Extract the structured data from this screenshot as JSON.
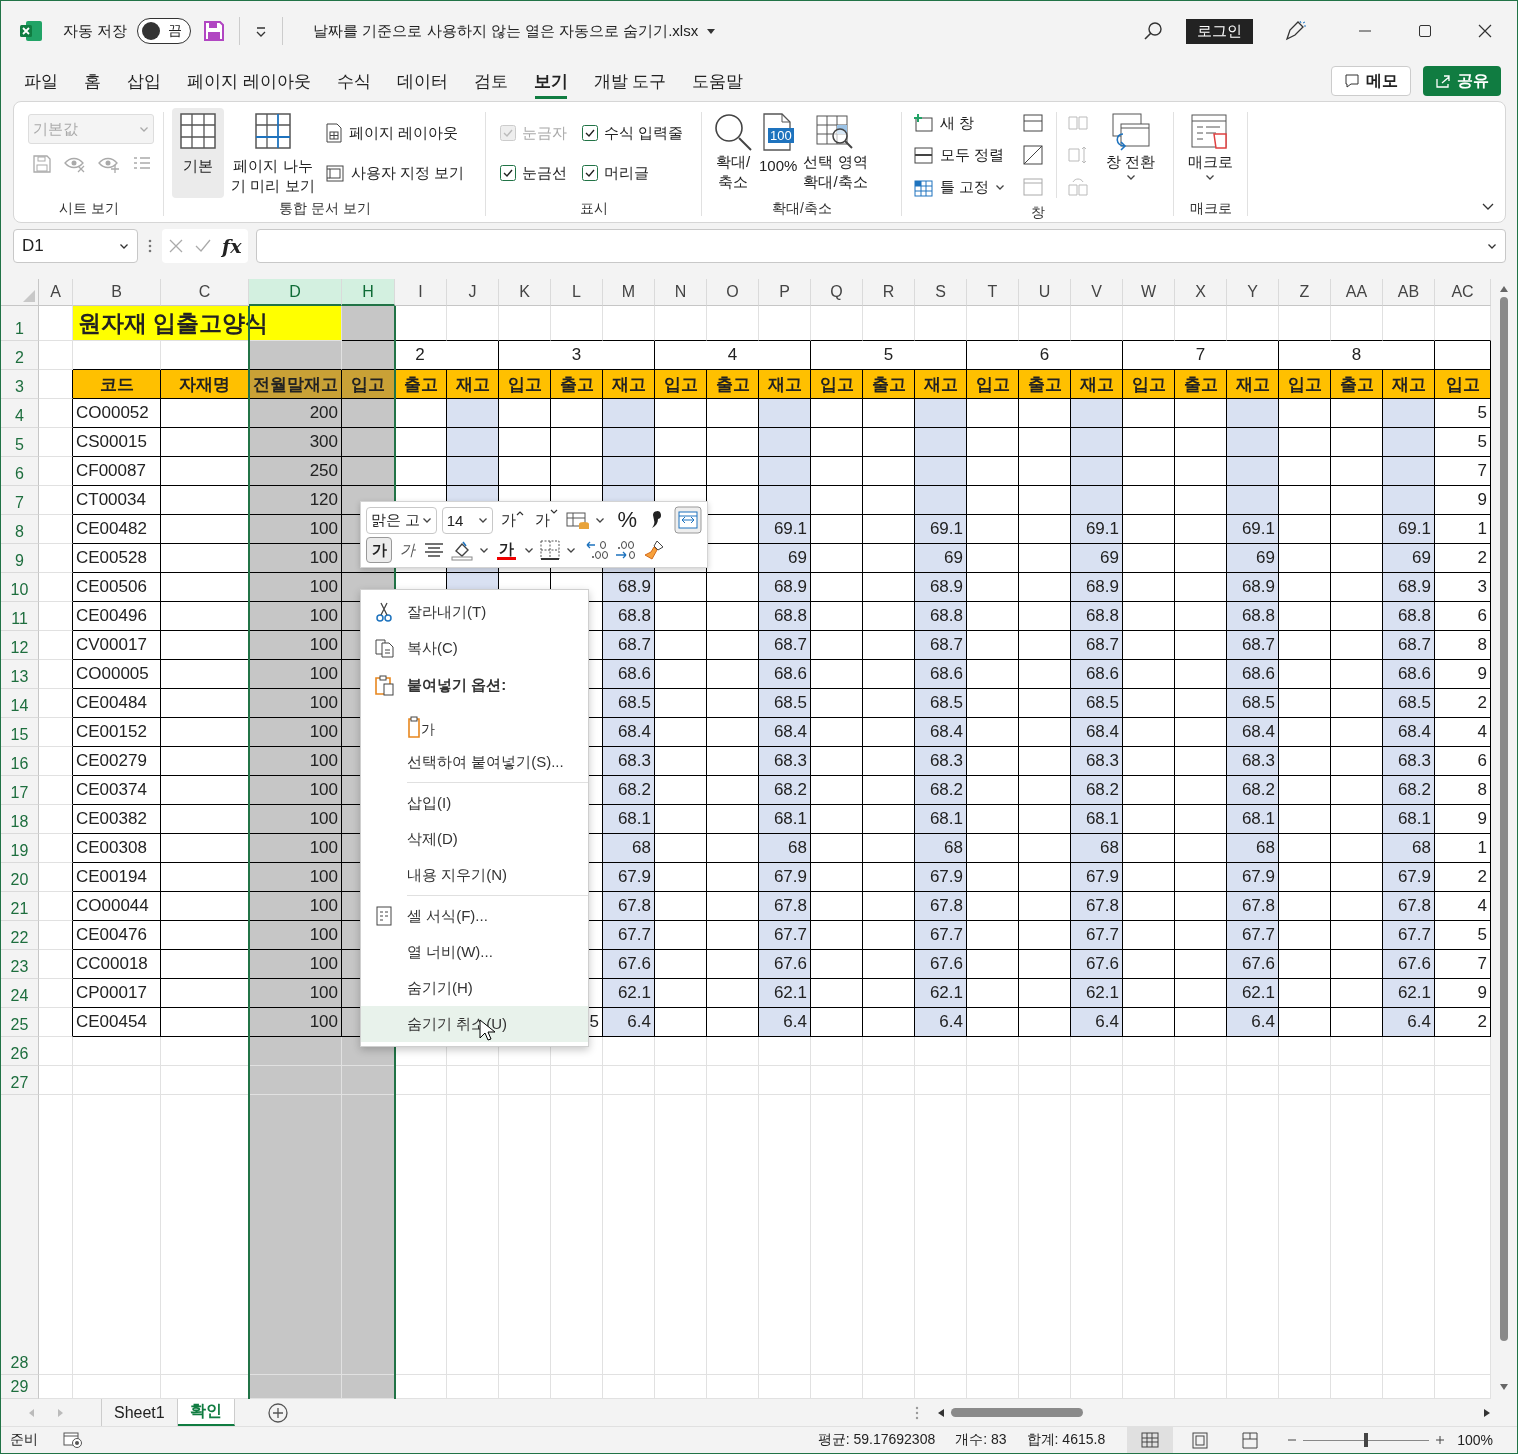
{
  "title_bar": {
    "autosave_label": "자동 저장",
    "autosave_toggle": {
      "label": "끔",
      "on": false
    },
    "file_name": "날짜를 기준으로 사용하지 않는 열은 자동으로 숨기기.xlsx",
    "login": "로그인"
  },
  "ribbon_tabs": [
    {
      "label": "파일",
      "selected": false
    },
    {
      "label": "홈",
      "selected": false
    },
    {
      "label": "삽입",
      "selected": false
    },
    {
      "label": "페이지 레이아웃",
      "selected": false
    },
    {
      "label": "수식",
      "selected": false
    },
    {
      "label": "데이터",
      "selected": false
    },
    {
      "label": "검토",
      "selected": false
    },
    {
      "label": "보기",
      "selected": true
    },
    {
      "label": "개발 도구",
      "selected": false
    },
    {
      "label": "도움말",
      "selected": false
    }
  ],
  "memo_button": "메모",
  "share_button": "공유",
  "ribbon": {
    "sheet_view": {
      "label": "시트 보기",
      "view_dropdown": {
        "value": "기본값",
        "disabled": true
      }
    },
    "workbook_views": {
      "label": "통합 문서 보기",
      "large_buttons": [
        {
          "label": "기본",
          "selected": true
        },
        {
          "label": "페이지 나누\n기 미리 보기",
          "selected": false
        }
      ],
      "small_buttons": [
        "페이지 레이아웃",
        "사용자 지정 보기"
      ]
    },
    "show": {
      "label": "표시",
      "checkboxes": [
        {
          "label": "눈금자",
          "checked": true,
          "disabled": true
        },
        {
          "label": "수식 입력줄",
          "checked": true,
          "disabled": false
        },
        {
          "label": "눈금선",
          "checked": true,
          "disabled": false
        },
        {
          "label": "머리글",
          "checked": true,
          "disabled": false
        }
      ]
    },
    "zoom": {
      "label": "확대/축소",
      "zoom_button": "확대/\n축소",
      "hundred_button": {
        "label": "100%",
        "badge": "100"
      },
      "selection_button": "선택 영역\n확대/축소"
    },
    "window": {
      "label": "창",
      "small_buttons": [
        "새 창",
        "모두 정렬",
        "틀 고정"
      ],
      "switch_button": "창 전환"
    },
    "macros": {
      "label": "매크로",
      "button": "매크로"
    }
  },
  "formula_bar": {
    "name_box": "D1",
    "function_label": "fx"
  },
  "sheet": {
    "columns": [
      {
        "label": "A",
        "selected": false,
        "shaded": false
      },
      {
        "label": "B",
        "selected": false,
        "shaded": false
      },
      {
        "label": "C",
        "selected": false,
        "shaded": false
      },
      {
        "label": "D",
        "selected": true,
        "shaded": false
      },
      {
        "label": "H",
        "selected": true,
        "shaded": false
      },
      {
        "label": "I",
        "selected": false,
        "shaded": false
      },
      {
        "label": "J",
        "selected": false,
        "shaded": true
      },
      {
        "label": "K",
        "selected": false,
        "shaded": false
      },
      {
        "label": "L",
        "selected": false,
        "shaded": false
      },
      {
        "label": "M",
        "selected": false,
        "shaded": true
      },
      {
        "label": "N",
        "selected": false,
        "shaded": false
      },
      {
        "label": "O",
        "selected": false,
        "shaded": false
      },
      {
        "label": "P",
        "selected": false,
        "shaded": true
      },
      {
        "label": "Q",
        "selected": false,
        "shaded": false
      },
      {
        "label": "R",
        "selected": false,
        "shaded": false
      },
      {
        "label": "S",
        "selected": false,
        "shaded": true
      },
      {
        "label": "T",
        "selected": false,
        "shaded": false
      },
      {
        "label": "U",
        "selected": false,
        "shaded": false
      },
      {
        "label": "V",
        "selected": false,
        "shaded": true
      },
      {
        "label": "W",
        "selected": false,
        "shaded": false
      },
      {
        "label": "X",
        "selected": false,
        "shaded": false
      },
      {
        "label": "Y",
        "selected": false,
        "shaded": true
      },
      {
        "label": "Z",
        "selected": false,
        "shaded": false
      },
      {
        "label": "AA",
        "selected": false,
        "shaded": false
      },
      {
        "label": "AB",
        "selected": false,
        "shaded": true
      },
      {
        "label": "AC",
        "selected": false,
        "shaded": false
      }
    ],
    "row_numbers": [
      "1",
      "2",
      "3",
      "4",
      "5",
      "6",
      "7",
      "8",
      "9",
      "10",
      "11",
      "12",
      "13",
      "14",
      "15",
      "16",
      "17",
      "18",
      "19",
      "20",
      "21",
      "22",
      "23",
      "24",
      "25",
      "26",
      "27",
      "28",
      "29"
    ],
    "title": "원자재 입출고양식",
    "months": [
      "2",
      "3",
      "4",
      "5",
      "6",
      "7",
      "8"
    ],
    "headers": [
      "코드",
      "자재명",
      "전월말재고",
      "입고",
      "출고",
      "재고",
      "입고",
      "출고",
      "재고",
      "입고",
      "출고",
      "재고",
      "입고",
      "출고",
      "재고",
      "입고",
      "출고",
      "재고",
      "입고",
      "출고",
      "재고",
      "입고",
      "출고",
      "재고",
      "입고"
    ],
    "rows": [
      {
        "code": "CO00052",
        "prev_stock": "200",
        "next_in": "5"
      },
      {
        "code": "CS00015",
        "prev_stock": "300",
        "next_in": "5"
      },
      {
        "code": "CF00087",
        "prev_stock": "250",
        "next_in": "7"
      },
      {
        "code": "CT00034",
        "prev_stock": "120",
        "next_in": "9"
      },
      {
        "code": "CE00482",
        "prev_stock": "100",
        "stock": [
          "69.1",
          "69.1",
          "69.1",
          "69.1",
          "69.1"
        ],
        "next_in": "1"
      },
      {
        "code": "CE00528",
        "prev_stock": "100",
        "stock": [
          "69",
          "69",
          "69",
          "69",
          "69"
        ],
        "next_in": "2"
      },
      {
        "code": "CE00506",
        "prev_stock": "100",
        "stock": [
          "68.9",
          "68.9",
          "68.9",
          "68.9",
          "68.9",
          "68.9"
        ],
        "next_in": "3"
      },
      {
        "code": "CE00496",
        "prev_stock": "100",
        "stock": [
          "68.8",
          "68.8",
          "68.8",
          "68.8",
          "68.8",
          "68.8"
        ],
        "next_in": "6"
      },
      {
        "code": "CV00017",
        "prev_stock": "100",
        "stock": [
          "68.7",
          "68.7",
          "68.7",
          "68.7",
          "68.7",
          "68.7"
        ],
        "next_in": "8"
      },
      {
        "code": "CO00005",
        "prev_stock": "100",
        "stock": [
          "68.6",
          "68.6",
          "68.6",
          "68.6",
          "68.6",
          "68.6"
        ],
        "next_in": "9"
      },
      {
        "code": "CE00484",
        "prev_stock": "100",
        "stock": [
          "68.5",
          "68.5",
          "68.5",
          "68.5",
          "68.5",
          "68.5"
        ],
        "next_in": "2"
      },
      {
        "code": "CE00152",
        "prev_stock": "100",
        "stock": [
          "68.4",
          "68.4",
          "68.4",
          "68.4",
          "68.4",
          "68.4"
        ],
        "next_in": "4"
      },
      {
        "code": "CE00279",
        "prev_stock": "100",
        "stock": [
          "68.3",
          "68.3",
          "68.3",
          "68.3",
          "68.3",
          "68.3"
        ],
        "next_in": "6"
      },
      {
        "code": "CE00374",
        "prev_stock": "100",
        "stock": [
          "68.2",
          "68.2",
          "68.2",
          "68.2",
          "68.2",
          "68.2"
        ],
        "next_in": "8"
      },
      {
        "code": "CE00382",
        "prev_stock": "100",
        "stock": [
          "68.1",
          "68.1",
          "68.1",
          "68.1",
          "68.1",
          "68.1"
        ],
        "next_in": "9"
      },
      {
        "code": "CE00308",
        "prev_stock": "100",
        "stock": [
          "68",
          "68",
          "68",
          "68",
          "68",
          "68"
        ],
        "next_in": "1"
      },
      {
        "code": "CE00194",
        "prev_stock": "100",
        "stock": [
          "67.9",
          "67.9",
          "67.9",
          "67.9",
          "67.9",
          "67.9"
        ],
        "next_in": "2"
      },
      {
        "code": "CO00044",
        "prev_stock": "100",
        "stock": [
          "67.8",
          "67.8",
          "67.8",
          "67.8",
          "67.8",
          "67.8"
        ],
        "next_in": "4"
      },
      {
        "code": "CE00476",
        "prev_stock": "100",
        "stock": [
          "67.7",
          "67.7",
          "67.7",
          "67.7",
          "67.7",
          "67.7"
        ],
        "next_in": "5"
      },
      {
        "code": "CC00018",
        "prev_stock": "100",
        "stock": [
          "67.6",
          "67.6",
          "67.6",
          "67.6",
          "67.6",
          "67.6"
        ],
        "next_in": "7"
      },
      {
        "code": "CP00017",
        "prev_stock": "100",
        "stock": [
          "62.1",
          "62.1",
          "62.1",
          "62.1",
          "62.1",
          "62.1"
        ],
        "next_in": "9"
      },
      {
        "code": "CE00454",
        "prev_stock": "100",
        "month3_out": "5",
        "stock": [
          "6.4",
          "6.4",
          "6.4",
          "6.4",
          "6.4",
          "6.4"
        ],
        "next_in": "2"
      }
    ]
  },
  "mini_toolbar": {
    "font": "맑은 고",
    "size": "14",
    "grow_font": "가",
    "shrink_font": "가",
    "percent": "%",
    "bold": {
      "label": "가",
      "on": true
    },
    "italic": "가",
    "font_color": "가"
  },
  "context_menu": {
    "items": [
      {
        "kind": "command",
        "label": "잘라내기(T)",
        "selected": false
      },
      {
        "kind": "command",
        "label": "복사(C)",
        "selected": false
      },
      {
        "kind": "heading",
        "label": "붙여넣기 옵션:"
      },
      {
        "kind": "paste_options",
        "label": "가"
      },
      {
        "kind": "command",
        "label": "선택하여 붙여넣기(S)...",
        "selected": false
      },
      {
        "kind": "separator"
      },
      {
        "kind": "command",
        "label": "삽입(I)",
        "selected": false
      },
      {
        "kind": "command",
        "label": "삭제(D)",
        "selected": false
      },
      {
        "kind": "command",
        "label": "내용 지우기(N)",
        "selected": false
      },
      {
        "kind": "separator"
      },
      {
        "kind": "command",
        "label": "셀 서식(F)...",
        "selected": false
      },
      {
        "kind": "command",
        "label": "열 너비(W)...",
        "selected": false
      },
      {
        "kind": "command",
        "label": "숨기기(H)",
        "selected": false
      },
      {
        "kind": "command",
        "label": "숨기기 취소(U)",
        "selected": true
      }
    ]
  },
  "sheet_tabs": [
    {
      "label": "Sheet1",
      "selected": false
    },
    {
      "label": "확인",
      "selected": true
    }
  ],
  "status_bar": {
    "mode": "준비",
    "average": "평균: 59.17692308",
    "count": "개수: 83",
    "sum": "합계: 4615.8",
    "views": [
      {
        "selected": true
      },
      {
        "selected": false
      },
      {
        "selected": false
      }
    ],
    "zoom_slider": {
      "level": 0.5
    },
    "zoom": "100%"
  }
}
